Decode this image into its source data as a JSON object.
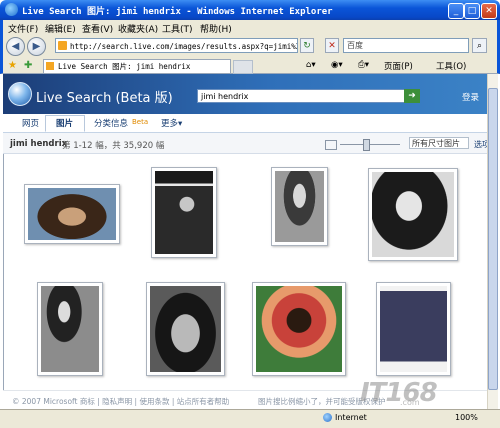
{
  "window": {
    "title": "Live Search 图片: jimi hendrix - Windows Internet Explorer",
    "minimize": "_",
    "maximize": "□",
    "close": "✕"
  },
  "menu": [
    "文件(F)",
    "编辑(E)",
    "查看(V)",
    "收藏夹(A)",
    "工具(T)",
    "帮助(H)"
  ],
  "address": {
    "url": "http://search.live.com/images/results.aspx?q=jimi%20hendrix",
    "search_placeholder": "百度"
  },
  "tab": {
    "title": "Live Search 图片: jimi hendrix"
  },
  "commands": {
    "page": "页面(P)",
    "tools": "工具(O)"
  },
  "live_search": {
    "brand": "Live Search (Beta 版)",
    "query": "jimi hendrix",
    "go": "➜",
    "signin": "登录",
    "nav": [
      {
        "label": "网页"
      },
      {
        "label": "图片"
      },
      {
        "label": "分类信息",
        "badge": "Beta"
      },
      {
        "label": "更多▾"
      }
    ],
    "results_query": "jimi hendrix",
    "results_count": "第 1-12 幅，共 35,920 幅",
    "size_filter": "所有尺寸图片",
    "options": "选项"
  },
  "footer": {
    "left": "© 2007 Microsoft  商标 | 隐私声明 | 使用条款 | 站点所有者帮助",
    "right": "图片搜比例缩小了，并可能受版权保护"
  },
  "status": {
    "zone": "Internet",
    "zoom": "100%"
  },
  "watermark": {
    "main": "IT168",
    "sub": ".com"
  },
  "colors": {
    "title_bar": "#0a55d8",
    "live_header": "#2f6fb9",
    "link": "#1a3f73"
  }
}
